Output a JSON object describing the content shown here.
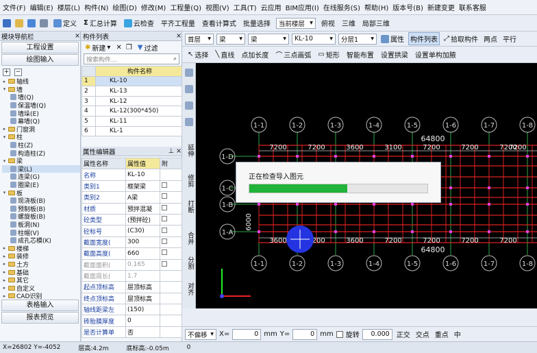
{
  "menu": [
    "文件(F)",
    "编辑(E)",
    "楼层(L)",
    "构件(N)",
    "绘图(D)",
    "修改(M)",
    "工程量(Q)",
    "视图(V)",
    "工具(T)",
    "云应用",
    "BIM应用(I)",
    "在线服务(S)",
    "帮助(H)",
    "版本号(B)",
    "新建变更",
    "联系客服"
  ],
  "toolbar1": {
    "define": "定义",
    "sum": "汇总计算",
    "cloud": "云检查",
    "level_table": "平齐工程量",
    "view_calc": "查看计算式",
    "batch": "批量选择",
    "current_floor": "当前楼层",
    "top_view": "俯视",
    "three_d": "三维",
    "local_3d": "局部三维"
  },
  "toolbar2": {
    "floor": "首层",
    "type1": "梁",
    "type2": "梁",
    "comp": "KL-10",
    "layer": "分层1",
    "props": "属性",
    "comp_list": "构件列表",
    "pick": "拾取构件",
    "two_points": "两点",
    "parallel": "平行"
  },
  "toolbar3": {
    "select": "选择",
    "line": "直线",
    "point_ext": "点加长度",
    "arc": "三点画弧",
    "rect": "矩形",
    "smart": "智能布置",
    "set_arch": "设置拱梁",
    "set_unit": "设置单构加腋"
  },
  "left_panel": {
    "title": "模块导航栏",
    "btn_project": "工程设置",
    "btn_draw": "绘图输入",
    "tree": [
      {
        "label": "轴线",
        "level": 0,
        "exp": "+"
      },
      {
        "label": "墙",
        "level": 0,
        "exp": "-"
      },
      {
        "label": "墙(Q)",
        "level": 1
      },
      {
        "label": "保温墙(Q)",
        "level": 1
      },
      {
        "label": "墙垛(E)",
        "level": 1
      },
      {
        "label": "幕墙(Q)",
        "level": 1
      },
      {
        "label": "门窗洞",
        "level": 0,
        "exp": "+"
      },
      {
        "label": "柱",
        "level": 0,
        "exp": "-"
      },
      {
        "label": "柱(Z)",
        "level": 1
      },
      {
        "label": "构造柱(Z)",
        "level": 1
      },
      {
        "label": "梁",
        "level": 0,
        "exp": "-"
      },
      {
        "label": "梁(L)",
        "level": 1
      },
      {
        "label": "连梁(G)",
        "level": 1
      },
      {
        "label": "圈梁(E)",
        "level": 1
      },
      {
        "label": "板",
        "level": 0,
        "exp": "-"
      },
      {
        "label": "现浇板(B)",
        "level": 1
      },
      {
        "label": "预制板(B)",
        "level": 1
      },
      {
        "label": "螺旋板(B)",
        "level": 1
      },
      {
        "label": "板洞(N)",
        "level": 1
      },
      {
        "label": "柱帽(V)",
        "level": 1
      },
      {
        "label": "成孔芯模(K)",
        "level": 1
      },
      {
        "label": "楼梯",
        "level": 0,
        "exp": "+"
      },
      {
        "label": "装修",
        "level": 0,
        "exp": "+"
      },
      {
        "label": "土方",
        "level": 0,
        "exp": "+"
      },
      {
        "label": "基础",
        "level": 0,
        "exp": "+"
      },
      {
        "label": "其它",
        "level": 0,
        "exp": "+"
      },
      {
        "label": "自定义",
        "level": 0,
        "exp": "+"
      },
      {
        "label": "CAD识别",
        "level": 0,
        "exp": "+"
      }
    ],
    "btn_table": "表格输入",
    "btn_report": "报表预览"
  },
  "comp_list": {
    "title": "构件列表",
    "new_label": "新建",
    "filter_label": "过滤",
    "search_placeholder": "搜索构件...",
    "col_name": "构件名称",
    "rows": [
      {
        "n": "1",
        "name": "KL-10"
      },
      {
        "n": "2",
        "name": "KL-13"
      },
      {
        "n": "3",
        "name": "KL-12"
      },
      {
        "n": "4",
        "name": "KL-12(300*450)"
      },
      {
        "n": "5",
        "name": "KL-11"
      },
      {
        "n": "6",
        "name": "KL-1"
      }
    ]
  },
  "prop_editor": {
    "title": "属性编辑器",
    "col_name": "属性名称",
    "col_value": "属性值",
    "col_attach": "附",
    "rows": [
      {
        "n": "名称",
        "v": "KL-10",
        "dim": false
      },
      {
        "n": "类别1",
        "v": "框架梁",
        "dim": false
      },
      {
        "n": "类别2",
        "v": "A梁",
        "dim": false
      },
      {
        "n": "材质",
        "v": "预拌混凝",
        "dim": false
      },
      {
        "n": "砼类型",
        "v": "(预拌砼)",
        "dim": false
      },
      {
        "n": "砼标号",
        "v": "(C30)",
        "dim": false
      },
      {
        "n": "截面宽度(",
        "v": "300",
        "dim": false
      },
      {
        "n": "截面高度(",
        "v": "660",
        "dim": false
      },
      {
        "n": "截面面积(",
        "v": "0.165",
        "dim": true
      },
      {
        "n": "截面周长(",
        "v": "1.7",
        "dim": true
      },
      {
        "n": "起点顶标高",
        "v": "层顶标高",
        "dim": false
      },
      {
        "n": "终点顶标高",
        "v": "层顶标高",
        "dim": false
      },
      {
        "n": "轴线距梁左",
        "v": "(150)",
        "dim": false
      },
      {
        "n": "砖胎膜厚度",
        "v": "0",
        "dim": false
      },
      {
        "n": "是否计算单",
        "v": "否",
        "dim": false
      }
    ]
  },
  "sidebar": [
    "延伸",
    "修剪",
    "打断",
    "合并",
    "分割",
    "对齐"
  ],
  "canvas": {
    "dim_total": "64800",
    "spans": [
      "7200",
      "7200",
      "3600",
      "3100",
      "7200",
      "7200",
      "7200",
      "7200"
    ],
    "bottom_spans": [
      "3600",
      "7200",
      "3600",
      "7200",
      "7200",
      "7200",
      "7200"
    ],
    "axes_top": [
      "1-1",
      "1-2",
      "1-3",
      "1-4",
      "1-5",
      "1-6",
      "1-7",
      "1-8"
    ],
    "axes_left": [
      "1-D",
      "1-C",
      "1-B",
      "1-A"
    ],
    "left_dims": [
      "6000",
      "8400"
    ]
  },
  "dialog": {
    "text": "正在检查导入图元",
    "progress": 0.55
  },
  "bottombar": {
    "no_offset": "不偏移",
    "x_label": "X=",
    "x_val": "0",
    "mm1": "mm",
    "y_label": "Y=",
    "y_val": "0",
    "mm2": "mm",
    "rotate": "旋转",
    "rot_val": "0.000",
    "ortho": "正交",
    "cross": "交点",
    "midpt": "重点",
    "center": "中"
  },
  "status": {
    "coords": "X=26802 Y=-4052",
    "floor_height": "层高:4.2m",
    "floor_bottom": "底标高:-0.05m",
    "zero": "0"
  }
}
